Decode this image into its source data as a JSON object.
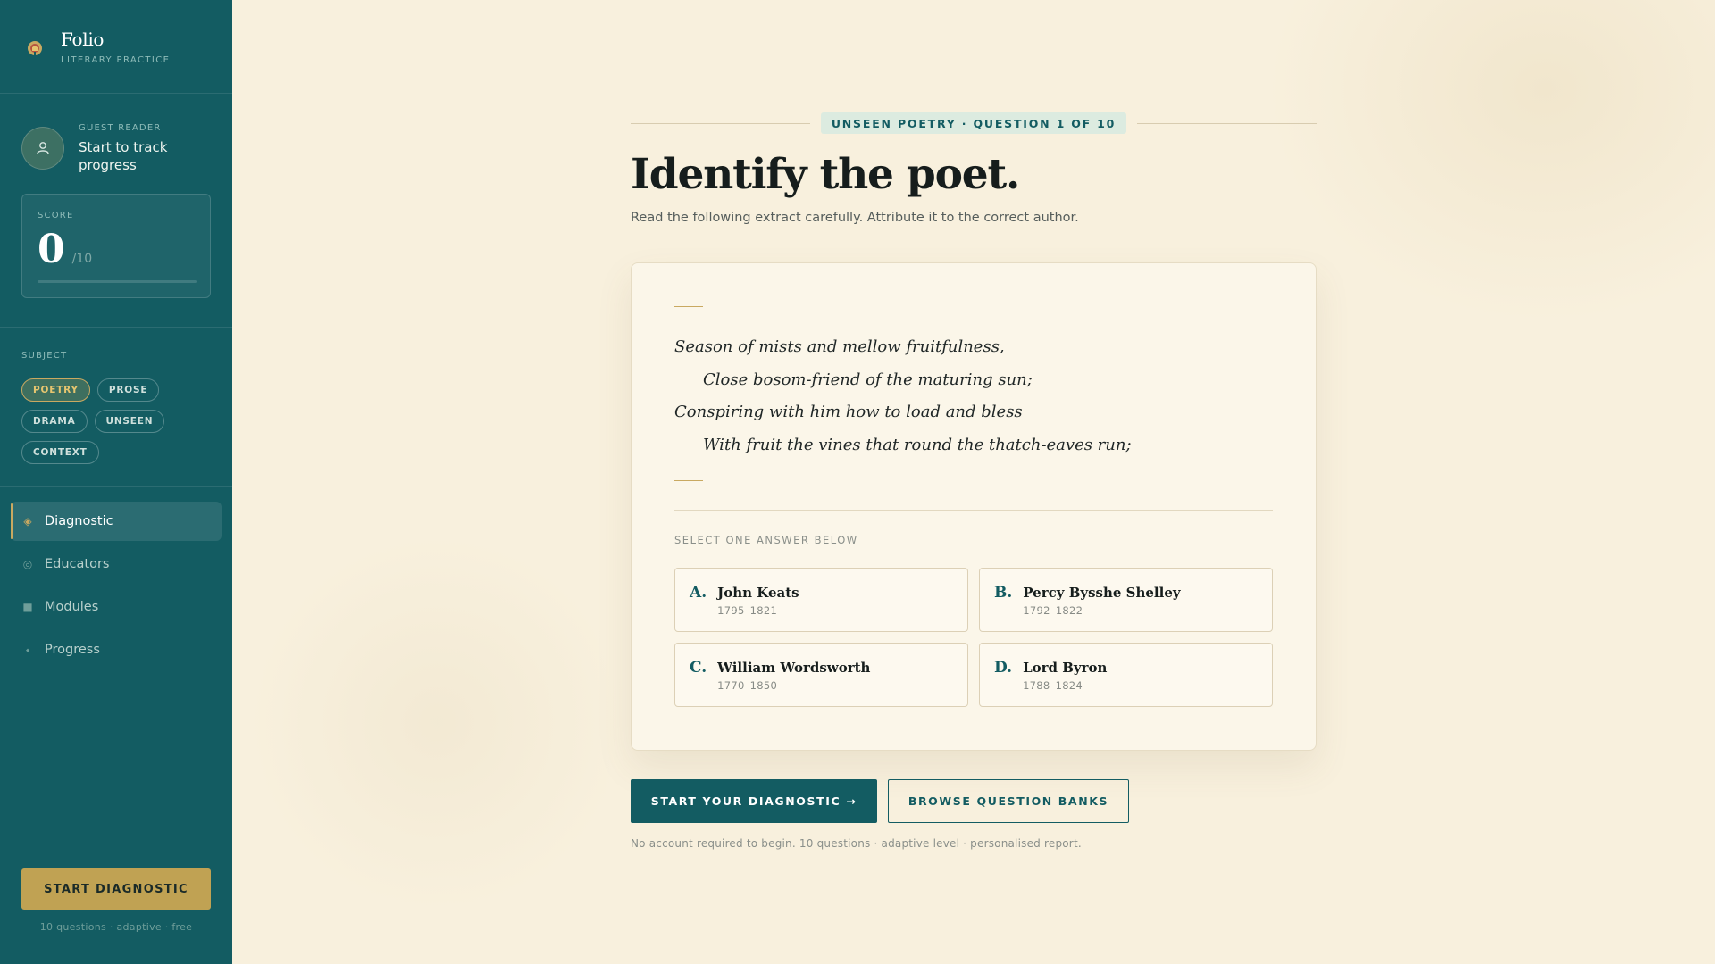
{
  "colors": {
    "sidebar_bg": "#135c62",
    "accent_gold": "#c9a961",
    "page_bg": "#f8f0dd",
    "primary": "#135c62"
  },
  "brand": {
    "name": "Folio",
    "subtitle": "LITERARY PRACTICE",
    "logo_icon": "book-seal-icon"
  },
  "guest": {
    "label": "GUEST READER",
    "text": "Start to track progress",
    "avatar_icon": "user-icon"
  },
  "score": {
    "label": "SCORE",
    "value": "0",
    "total": "/10",
    "progress_fraction": 0
  },
  "subject": {
    "label": "SUBJECT",
    "chips": [
      {
        "label": "POETRY",
        "active": true
      },
      {
        "label": "PROSE",
        "active": false
      },
      {
        "label": "DRAMA",
        "active": false
      },
      {
        "label": "UNSEEN",
        "active": false
      },
      {
        "label": "CONTEXT",
        "active": false
      }
    ]
  },
  "nav": {
    "items": [
      {
        "label": "Diagnostic",
        "icon": "diamond-icon",
        "glyph": "◈",
        "active": true
      },
      {
        "label": "Educators",
        "icon": "target-icon",
        "glyph": "◎",
        "active": false
      },
      {
        "label": "Modules",
        "icon": "square-icon",
        "glyph": "■",
        "active": false
      },
      {
        "label": "Progress",
        "icon": "dot-icon",
        "glyph": "⬩",
        "active": false
      }
    ]
  },
  "sidebar_cta": {
    "label": "START DIAGNOSTIC",
    "note": "10 questions · adaptive · free"
  },
  "question": {
    "eyebrow": "UNSEEN POETRY · QUESTION 1 OF 10",
    "title": "Identify the poet.",
    "subtitle": "Read the following extract carefully. Attribute it to the correct author.",
    "poem": [
      "Season of mists and mellow fruitfulness,",
      "Close bosom-friend of the maturing sun;",
      "Conspiring with him how to load and bless",
      "With fruit the vines that round the thatch-eaves run;"
    ],
    "select_label": "SELECT ONE ANSWER BELOW",
    "answers": [
      {
        "letter": "A.",
        "name": "John Keats",
        "years": "1795–1821"
      },
      {
        "letter": "B.",
        "name": "Percy Bysshe Shelley",
        "years": "1792–1822"
      },
      {
        "letter": "C.",
        "name": "William Wordsworth",
        "years": "1770–1850"
      },
      {
        "letter": "D.",
        "name": "Lord Byron",
        "years": "1788–1824"
      }
    ]
  },
  "cta": {
    "primary": "START YOUR DIAGNOSTIC →",
    "secondary": "BROWSE QUESTION BANKS",
    "note": "No account required to begin. 10 questions · adaptive level · personalised report."
  }
}
